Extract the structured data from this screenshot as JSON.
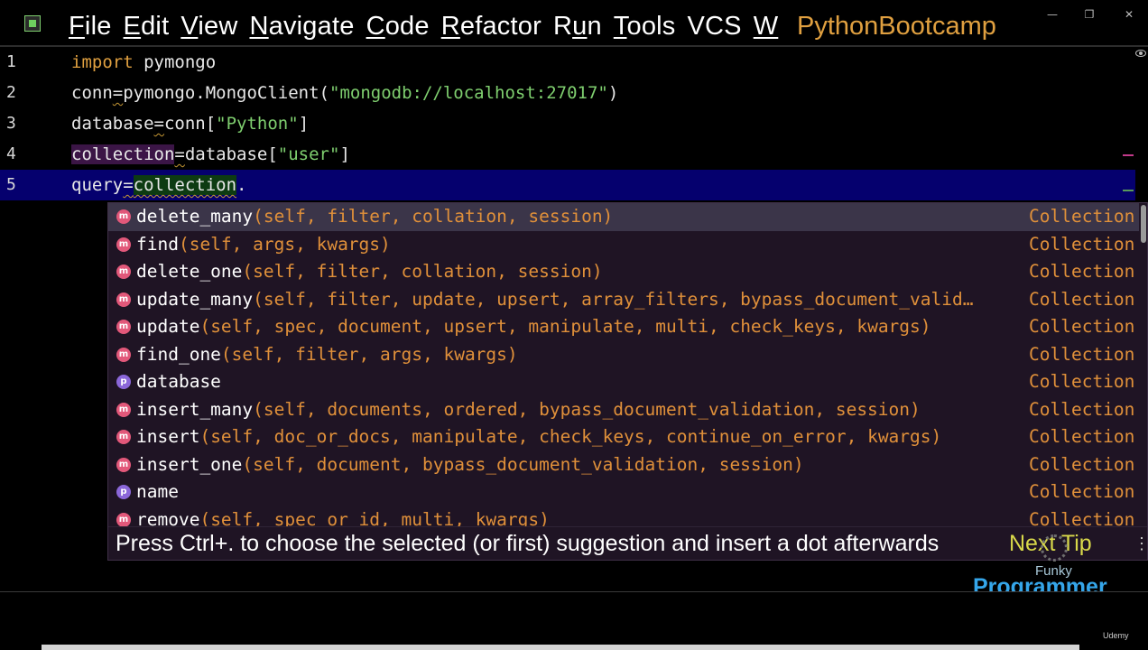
{
  "menu": {
    "items": [
      {
        "underline": "F",
        "rest": "ile"
      },
      {
        "underline": "E",
        "rest": "dit"
      },
      {
        "underline": "V",
        "rest": "iew"
      },
      {
        "underline": "N",
        "rest": "avigate"
      },
      {
        "underline": "C",
        "rest": "ode"
      },
      {
        "underline": "R",
        "rest": "efactor"
      },
      {
        "underline": "",
        "rest": "R",
        "underline2": "u",
        "rest2": "n"
      },
      {
        "underline": "T",
        "rest": "ools"
      },
      {
        "underline": "",
        "rest": "VCS"
      },
      {
        "underline": "W",
        "rest": ""
      }
    ],
    "project": "PythonBootcamp"
  },
  "editor": {
    "line_numbers": [
      "1",
      "2",
      "3",
      "4",
      "5"
    ],
    "lines": {
      "l1_kw": "import",
      "l1_rest": " pymongo",
      "l2_var": "conn",
      "l2_eq": "=",
      "l2_call": "pymongo.MongoClient(",
      "l2_str": "\"mongodb://localhost:27017\"",
      "l2_close": ")",
      "l3_var": "database",
      "l3_eq": "=",
      "l3_call": "conn[",
      "l3_str": "\"Python\"",
      "l3_close": "]",
      "l4_var": "collection",
      "l4_eq": "=",
      "l4_call": "database[",
      "l4_str": "\"user\"",
      "l4_close": "]",
      "l5_var": "query",
      "l5_eq": "=",
      "l5_ref": "collection",
      "l5_dot": "."
    }
  },
  "completion": {
    "items": [
      {
        "kind": "m",
        "name": "delete_many",
        "params": "(self, filter, collation, session)",
        "type": "Collection"
      },
      {
        "kind": "m",
        "name": "find",
        "params": "(self, args, kwargs)",
        "type": "Collection"
      },
      {
        "kind": "m",
        "name": "delete_one",
        "params": "(self, filter, collation, session)",
        "type": "Collection"
      },
      {
        "kind": "m",
        "name": "update_many",
        "params": "(self, filter, update, upsert, array_filters, bypass_document_valid…",
        "type": "Collection"
      },
      {
        "kind": "m",
        "name": "update",
        "params": "(self, spec, document, upsert, manipulate, multi, check_keys, kwargs)",
        "type": "Collection"
      },
      {
        "kind": "m",
        "name": "find_one",
        "params": "(self, filter, args, kwargs)",
        "type": "Collection"
      },
      {
        "kind": "p",
        "name": "database",
        "params": "",
        "type": "Collection"
      },
      {
        "kind": "m",
        "name": "insert_many",
        "params": "(self, documents, ordered, bypass_document_validation, session)",
        "type": "Collection"
      },
      {
        "kind": "m",
        "name": "insert",
        "params": "(self, doc_or_docs, manipulate, check_keys, continue_on_error, kwargs)",
        "type": "Collection"
      },
      {
        "kind": "m",
        "name": "insert_one",
        "params": "(self, document, bypass_document_validation, session)",
        "type": "Collection"
      },
      {
        "kind": "p",
        "name": "name",
        "params": "",
        "type": "Collection"
      },
      {
        "kind": "m",
        "name": "remove",
        "params": "(self, spec_or_id, multi, kwargs)",
        "type": "Collection"
      }
    ],
    "selected_index": 0,
    "tip_text": "Press Ctrl+. to choose the selected (or first) suggestion and insert a dot afterwards",
    "tip_link": "Next Tip"
  },
  "watermark": {
    "line1": "Funky",
    "line2": "Programmer",
    "platform": "Udemy"
  },
  "colors": {
    "current_line": "#05006e",
    "keyword": "#e0a040",
    "string": "#7fcf6f",
    "popup_bg": "#1f1424",
    "method_icon": "#e2587a",
    "property_icon": "#8b67d9"
  }
}
